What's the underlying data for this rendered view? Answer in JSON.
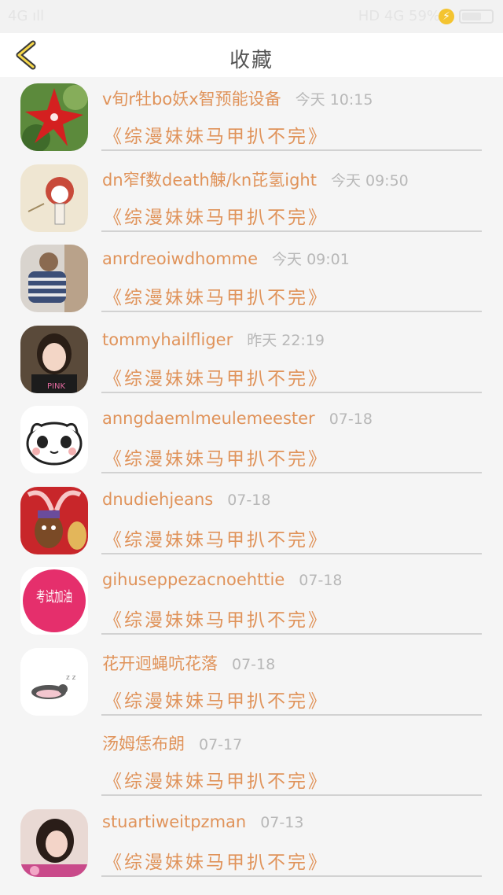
{
  "status": {
    "left": "4G ıll",
    "time": "",
    "right": "HD 4G 59%",
    "bolt": "⚡"
  },
  "header": {
    "title": "收藏"
  },
  "items": [
    {
      "name": "v旬r牡bo妖x智预能设备",
      "time": "今天 10:15",
      "work": "《综漫妹妹马甲扒不完》",
      "avatar": "red-pinwheel"
    },
    {
      "name": "dn窄f数death觫/kn芘氢ight",
      "time": "今天 09:50",
      "work": "《综漫妹妹马甲扒不完》",
      "avatar": "cartoon-girl"
    },
    {
      "name": "anrdreoiwdhomme",
      "time": "今天 09:01",
      "work": "《综漫妹妹马甲扒不完》",
      "avatar": "striped-person"
    },
    {
      "name": "tommyhailfliger",
      "time": "昨天 22:19",
      "work": "《综漫妹妹马甲扒不完》",
      "avatar": "girl-photo"
    },
    {
      "name": "anngdaemlmeulemeester",
      "time": "07-18",
      "work": "《综漫妹妹马甲扒不完》",
      "avatar": "panda-face"
    },
    {
      "name": "dnudiehjeans",
      "time": "07-18",
      "work": "《综漫妹妹马甲扒不完》",
      "avatar": "brown-cartoon"
    },
    {
      "name": "gihuseppezacnoehttie",
      "time": "07-18",
      "work": "《综漫妹妹马甲扒不完》",
      "avatar": "exam-badge",
      "avatar_text": "考试加油"
    },
    {
      "name": "花开迥蝇吭花落",
      "time": "07-18",
      "work": "《综漫妹妹马甲扒不完》",
      "avatar": "lying-penguin"
    },
    {
      "name": "汤姆恁布朗",
      "time": "07-17",
      "work": "《综漫妹妹马甲扒不完》",
      "avatar": "none"
    },
    {
      "name": "stuartiweitpzman",
      "time": "07-13",
      "work": "《综漫妹妹马甲扒不完》",
      "avatar": "girl-photo-2"
    }
  ]
}
